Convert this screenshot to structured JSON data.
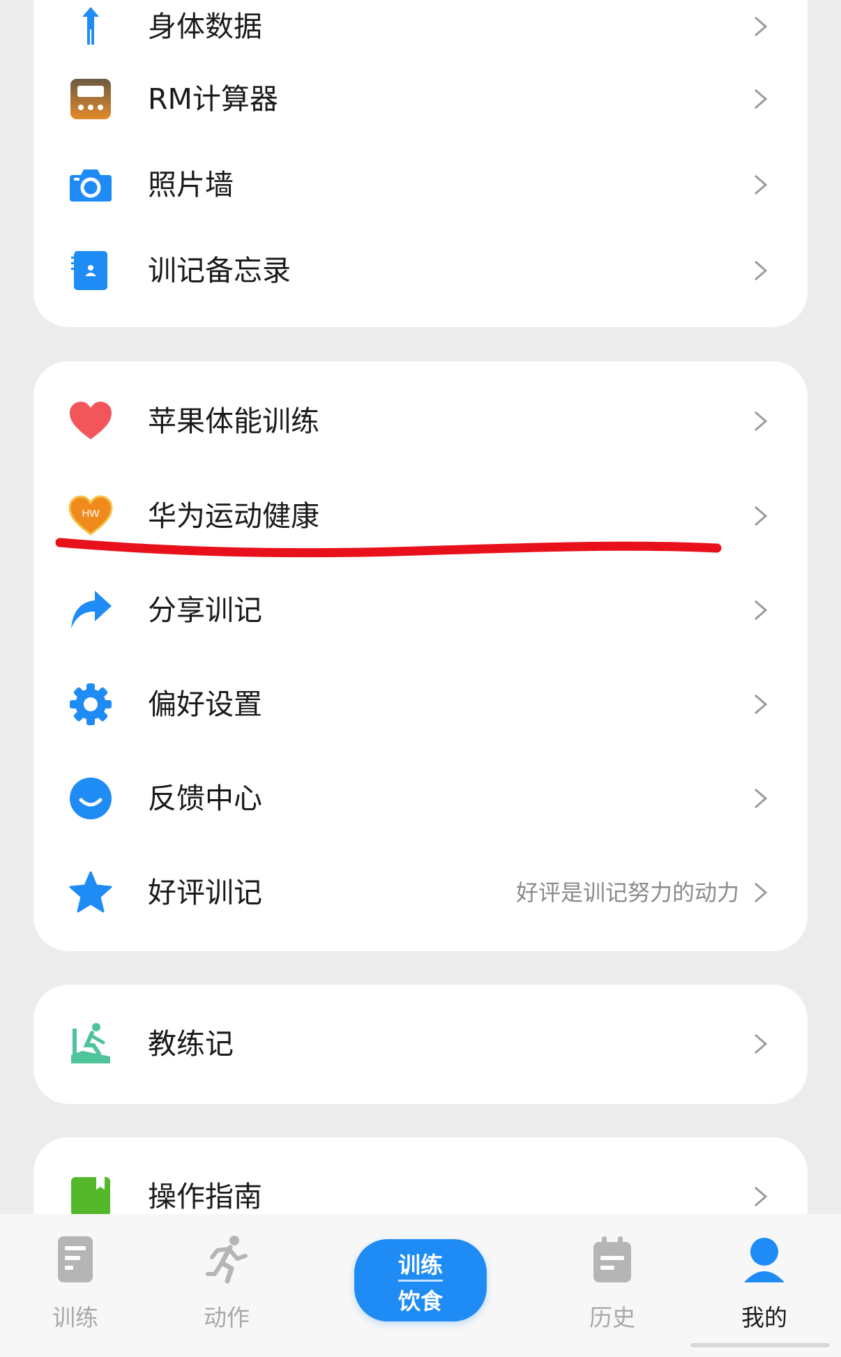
{
  "menu": {
    "group1": [
      {
        "label": "身体数据",
        "icon": "body-figure-icon"
      },
      {
        "label": "RM计算器",
        "icon": "calculator-icon"
      },
      {
        "label": "照片墙",
        "icon": "camera-icon"
      },
      {
        "label": "训记备忘录",
        "icon": "memo-notebook-icon"
      }
    ],
    "group2": [
      {
        "label": "苹果体能训练",
        "icon": "heart-icon"
      },
      {
        "label": "华为运动健康",
        "icon": "huawei-health-heart-icon",
        "icon_text": "HW"
      },
      {
        "label": "分享训记",
        "icon": "share-arrow-icon"
      },
      {
        "label": "偏好设置",
        "icon": "gear-icon"
      },
      {
        "label": "反馈中心",
        "icon": "smile-icon"
      },
      {
        "label": "好评训记",
        "icon": "star-icon",
        "hint": "好评是训记努力的动力"
      }
    ],
    "group3": [
      {
        "label": "教练记",
        "icon": "coach-rowing-icon"
      }
    ],
    "group4": [
      {
        "label": "操作指南",
        "icon": "guide-book-icon"
      }
    ]
  },
  "tabbar": {
    "tabs": [
      {
        "label": "训练",
        "icon": "training-doc-icon",
        "active": false
      },
      {
        "label": "动作",
        "icon": "running-person-icon",
        "active": false
      },
      {
        "label": "历史",
        "icon": "calendar-icon",
        "active": false
      },
      {
        "label": "我的",
        "icon": "user-icon",
        "active": true
      }
    ],
    "center_button": {
      "line1": "训练",
      "line2": "饮食"
    }
  },
  "colors": {
    "accent_blue": "#1f8bf5",
    "heart_red": "#f2555a",
    "huawei_orange": "#f08a1d",
    "annotation_red": "#e8101a",
    "coach_green": "#4fc39a",
    "guide_green": "#55b82a",
    "tab_inactive": "#a9a9a9"
  }
}
